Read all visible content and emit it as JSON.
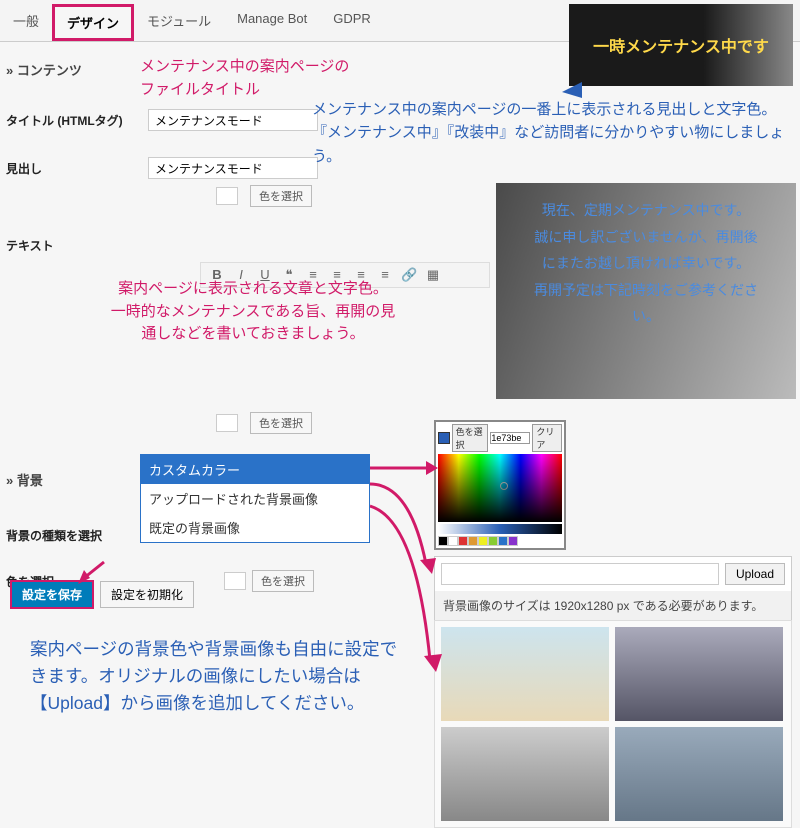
{
  "tabs": [
    "一般",
    "デザイン",
    "モジュール",
    "Manage Bot",
    "GDPR"
  ],
  "activeTab": 1,
  "sections": {
    "contents": "» コンテンツ",
    "background": "» 背景"
  },
  "fields": {
    "titleLabel": "タイトル (HTMLタグ)",
    "titleValue": "メンテナンスモード",
    "headingLabel": "見出し",
    "headingValue": "メンテナンスモード",
    "textLabel": "テキスト",
    "bgTypeLabel": "背景の種類を選択",
    "colorSelectLabel": "色を選択",
    "colorBtn": "色を選択"
  },
  "dropdown": {
    "items": [
      "カスタムカラー",
      "アップロードされた背景画像",
      "既定の背景画像"
    ],
    "selected": 0
  },
  "colorpicker": {
    "hexLabel": "色を選択",
    "hexValue": "1e73be",
    "clear": "クリア"
  },
  "upload": {
    "btn": "Upload",
    "hint": "背景画像のサイズは 1920x1280 px である必要があります。"
  },
  "buttons": {
    "save": "設定を保存",
    "reset": "設定を初期化"
  },
  "annotations": {
    "pink1": "メンテナンス中の案内ページの\nファイルタイトル",
    "blue1": "メンテナンス中の案内ページの一番上に表示される見出しと文字色。『メンテナンス中』『改装中』など訪問者に分かりやすい物にしましょう。",
    "pink2": "案内ページに表示される文章と文字色。\n一時的なメンテナンスである旨、再開の見\n通しなどを書いておきましょう。",
    "blue2": "案内ページの背景色や背景画像も自由に設定できます。オリジナルの画像にしたい場合は【Upload】から画像を追加してください。"
  },
  "preview": {
    "headerText": "一時メンテナンス中です",
    "bodyText": "現在、定期メンテナンス中です。\n誠に申し訳ございませんが、再開後\nにまたお越し頂ければ幸いです。\n再開予定は下記時刻をご参考くださ\nい。"
  }
}
